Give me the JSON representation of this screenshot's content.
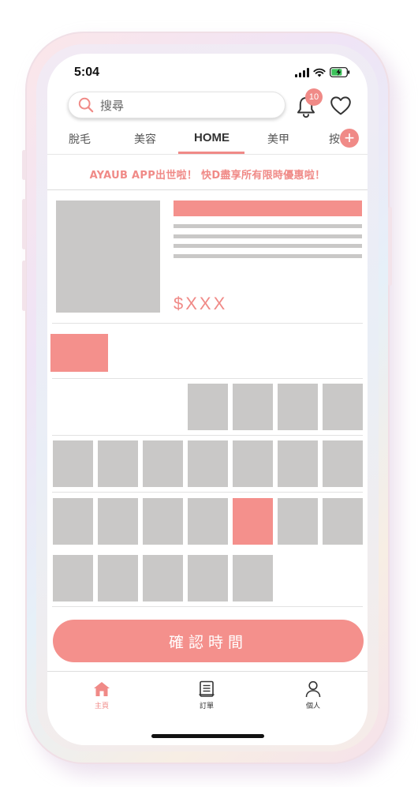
{
  "status_bar": {
    "time": "5:04"
  },
  "search": {
    "placeholder": "搜尋"
  },
  "notifications": {
    "count": "10"
  },
  "tabs": [
    {
      "label": "脫毛"
    },
    {
      "label": "美容"
    },
    {
      "label": "HOME",
      "active": true
    },
    {
      "label": "美甲"
    },
    {
      "label": "按"
    }
  ],
  "banner": {
    "text": "AYAUB APP出世啦！ 快D盡享所有限時優惠啦！"
  },
  "product": {
    "price": "$XXX"
  },
  "confirm_button": {
    "label": "確認時間"
  },
  "bottom_nav": [
    {
      "label": "主頁",
      "icon": "home-icon",
      "active": true
    },
    {
      "label": "訂單",
      "icon": "orders-icon",
      "active": false
    },
    {
      "label": "個人",
      "icon": "profile-icon",
      "active": false
    }
  ],
  "colors": {
    "accent": "#f08a87",
    "placeholder_gray": "#c9c8c7",
    "text": "#333333"
  }
}
